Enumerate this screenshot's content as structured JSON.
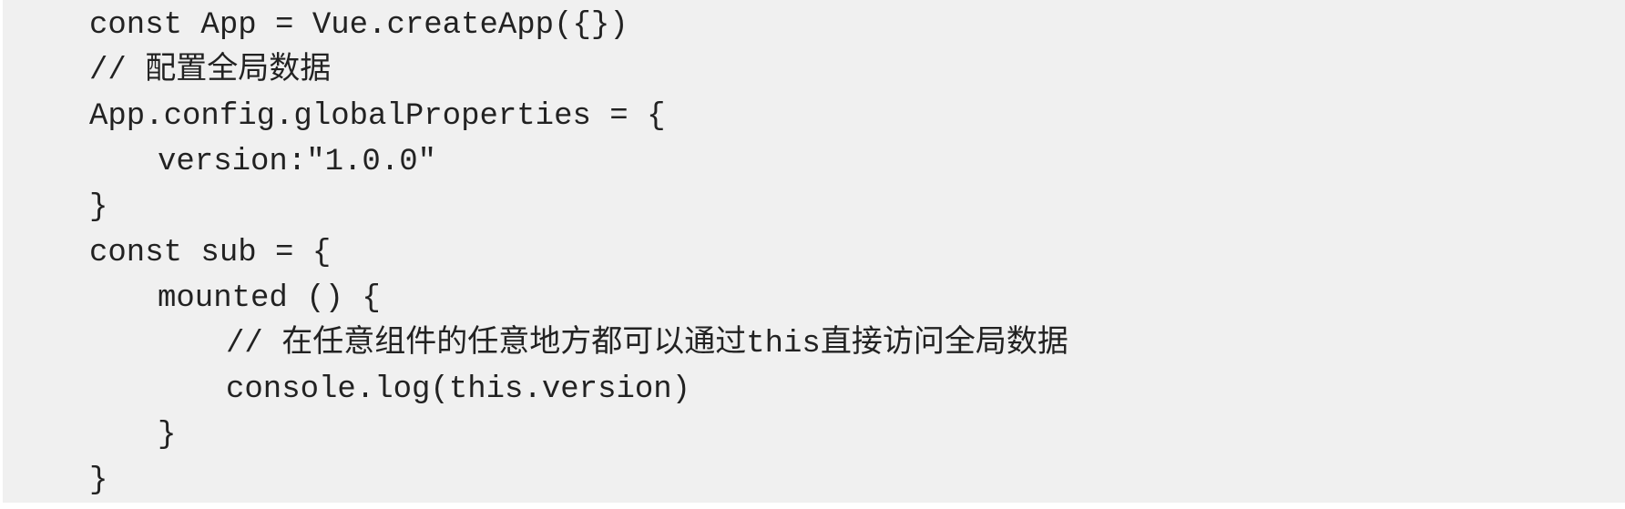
{
  "code": {
    "lines": [
      "const App = Vue.createApp({})",
      "// 配置全局数据",
      "App.config.globalProperties = {",
      "version:\"1.0.0\"",
      "}",
      "const sub = {",
      "mounted () {",
      "// 在任意组件的任意地方都可以通过this直接访问全局数据",
      "console.log(this.version)",
      "}",
      "}"
    ]
  }
}
